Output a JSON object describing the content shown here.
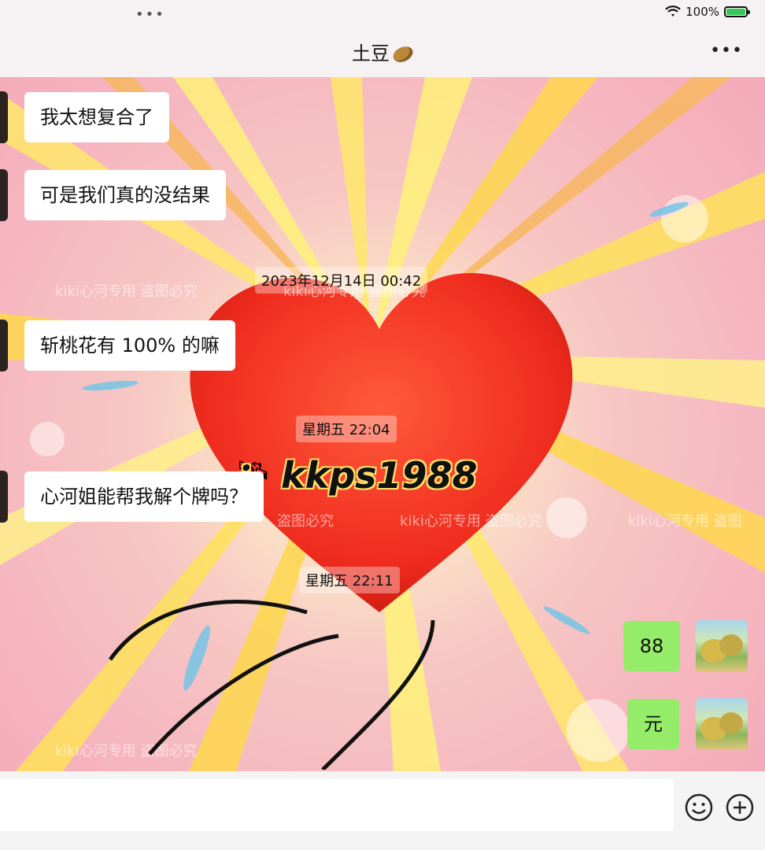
{
  "status": {
    "battery": "100%"
  },
  "header": {
    "title": "土豆",
    "more_icon": "more-icon"
  },
  "background": {
    "heart_text": "kkps1988",
    "heart_prefix": "：",
    "watermarks": [
      "kiki心河专用 盗图必究",
      "kiki心河专用 盗图必究",
      "盗图必究",
      "kiki心河专用 盗图必究",
      "kiki心河专用 盗图",
      "kiki心河专用 盗图必究"
    ]
  },
  "messages": [
    {
      "side": "left",
      "text": "我太想复合了"
    },
    {
      "side": "left",
      "text": "可是我们真的没结果"
    },
    {
      "type": "time",
      "text": "2023年12月14日 00:42"
    },
    {
      "side": "left",
      "text": "斩桃花有 100% 的嘛"
    },
    {
      "type": "time",
      "text": "星期五 22:04"
    },
    {
      "side": "left",
      "text": "心河姐能帮我解个牌吗？"
    },
    {
      "type": "time",
      "text": "星期五 22:11"
    },
    {
      "side": "right",
      "text": "88"
    },
    {
      "side": "right",
      "text": "元"
    }
  ]
}
